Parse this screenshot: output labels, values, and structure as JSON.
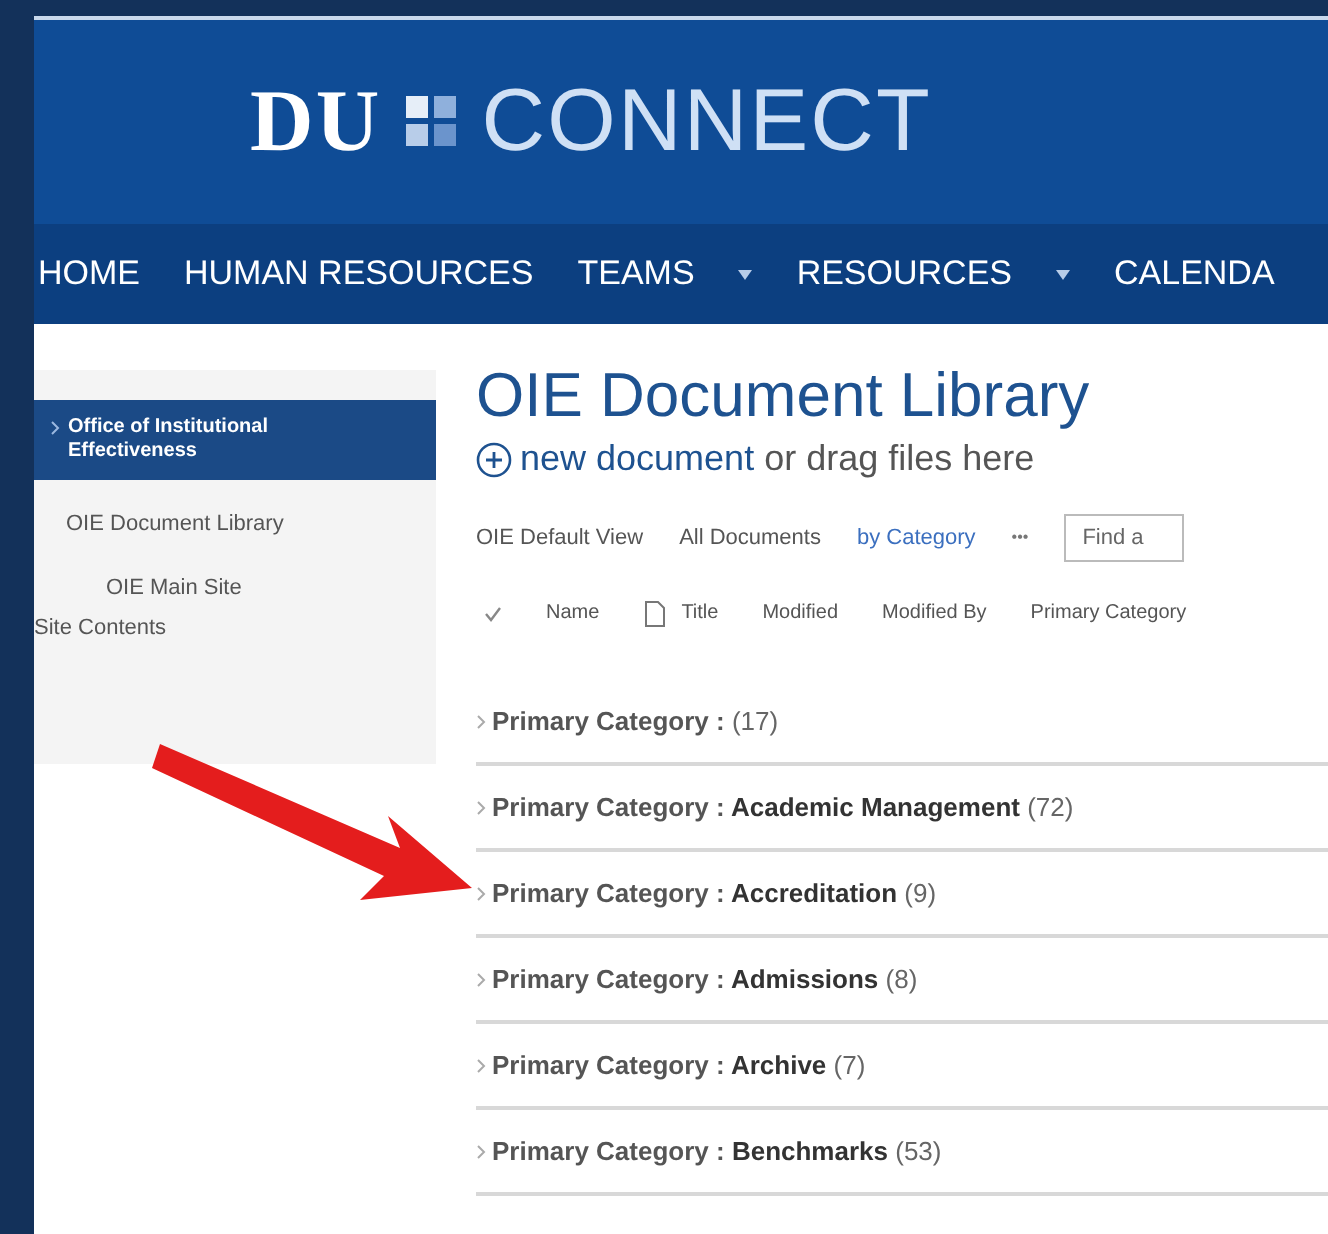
{
  "logo": {
    "left": "DU",
    "right": "CONNECT"
  },
  "nav": [
    {
      "label": "HOME",
      "dropdown": false
    },
    {
      "label": "HUMAN RESOURCES",
      "dropdown": false
    },
    {
      "label": "TEAMS",
      "dropdown": true
    },
    {
      "label": "RESOURCES",
      "dropdown": true
    },
    {
      "label": "CALENDA",
      "dropdown": false
    }
  ],
  "sidebar": {
    "items": [
      {
        "label": "Office of Institutional Effectiveness",
        "selected": true,
        "children": [
          {
            "label": "OIE Document Library",
            "selected": false,
            "children": [
              {
                "label": "OIE Main Site",
                "selected": false
              }
            ]
          }
        ]
      }
    ],
    "footer_link": "Site Contents"
  },
  "library": {
    "title": "OIE Document Library",
    "new_link": "new document",
    "new_rest": " or drag files here",
    "views": [
      {
        "label": "OIE Default View",
        "selected": false
      },
      {
        "label": "All Documents",
        "selected": false
      },
      {
        "label": "by Category",
        "selected": true
      }
    ],
    "more": "•••",
    "search": {
      "placeholder": "Find a"
    },
    "columns": [
      "Name",
      "Title",
      "Modified",
      "Modified By",
      "Primary Category"
    ],
    "groups": [
      {
        "label": "Primary Category :",
        "count": "(17)"
      },
      {
        "label": "Primary Category :",
        "value": "Academic Management",
        "count": "(72)"
      },
      {
        "label": "Primary Category :",
        "value": "Accreditation",
        "count": "(9)"
      },
      {
        "label": "Primary Category :",
        "value": "Admissions",
        "count": "(8)"
      },
      {
        "label": "Primary Category :",
        "value": "Archive",
        "count": "(7)"
      },
      {
        "label": "Primary Category :",
        "value": "Benchmarks",
        "count": "(53)"
      }
    ]
  }
}
